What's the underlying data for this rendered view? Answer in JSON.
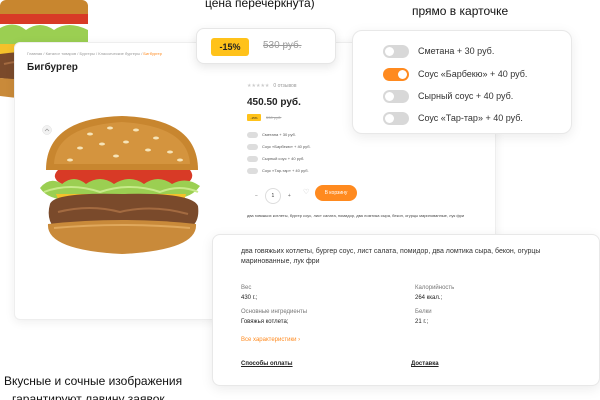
{
  "captions": {
    "price_struck": "цена перечеркнута)",
    "in_card": "прямо в карточке",
    "bottom_line1": "Вкусные и сочные изображения",
    "bottom_line2": "гарантируют лавину заявок"
  },
  "price_callout": {
    "discount": "-15%",
    "old_price": "530 руб."
  },
  "options": [
    {
      "label": "Сметана + 30 руб.",
      "checked": false
    },
    {
      "label": "Соус «Барбекю» + 40 руб.",
      "checked": true
    },
    {
      "label": "Сырный соус + 40 руб.",
      "checked": false
    },
    {
      "label": "Соус «Тар-тар» + 40 руб.",
      "checked": false
    }
  ],
  "product_page": {
    "breadcrumb": [
      "Главная",
      "Каталог товаров",
      "Бургеры",
      "Классические бургеры",
      "Бигбургер"
    ],
    "title": "Бигбургер",
    "rating_stars": "★★★★★",
    "rating_text": "0 отзывов",
    "price": "450.50 руб.",
    "mini_discount": "-15%",
    "mini_old_price": "530 руб.",
    "qty": "1",
    "qty_minus": "−",
    "qty_plus": "+",
    "cart_button": "В корзину",
    "short_desc": "два говяжьих котлеты, бургер соус, лист салата, помидор, два ломтика сыра, бекон, огурцы маринованные, лук фри"
  },
  "details": {
    "description": "два говяжьих котлеты, бургер соус, лист салата, помидор, два ломтика сыра, бекон, огурцы маринованные, лук фри",
    "weight_label": "Вес",
    "weight_value": "430 г.;",
    "calories_label": "Калорийность",
    "calories_value": "264 ккал.;",
    "ingredients_label": "Основные ингредиенты",
    "ingredients_value": "Говяжья котлета;",
    "protein_label": "Белки",
    "protein_value": "21 г.;",
    "all_specs_link": "Все характеристики",
    "tab_payment": "Способы оплаты",
    "tab_delivery": "Доставка"
  },
  "colors": {
    "accent_orange": "#ff8a1f",
    "discount_yellow": "#ffc21a"
  }
}
